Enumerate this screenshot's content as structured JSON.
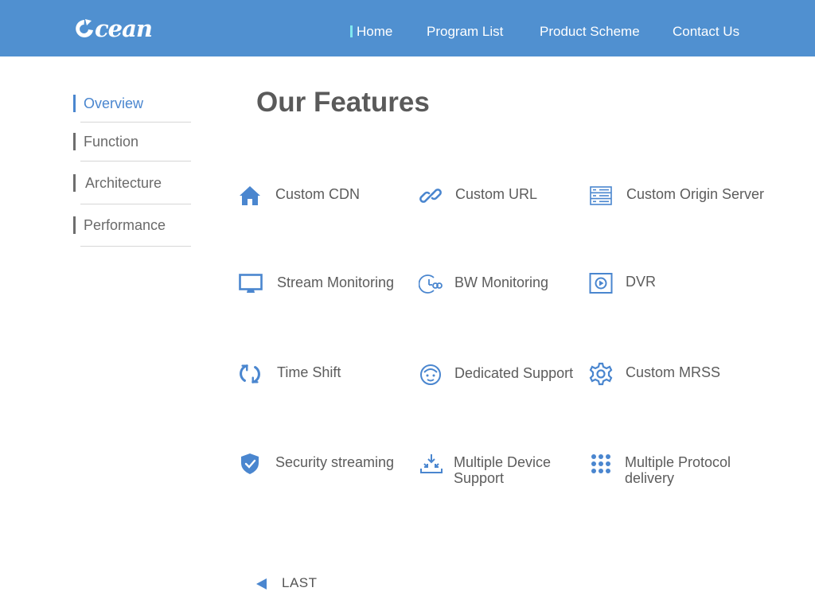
{
  "colors": {
    "header_bg": "#5090d0",
    "accent": "#4a86cf",
    "nav_active_marker": "#7fe8f0",
    "text": "#5c5c5c"
  },
  "logo": {
    "text": "cean"
  },
  "nav": {
    "items": [
      {
        "label": "Home",
        "active": true
      },
      {
        "label": "Program List",
        "active": false
      },
      {
        "label": "Product Scheme",
        "active": false
      },
      {
        "label": "Contact Us",
        "active": false
      }
    ]
  },
  "sidebar": {
    "items": [
      {
        "label": "Overview",
        "active": true
      },
      {
        "label": "Function",
        "active": false
      },
      {
        "label": "Architecture",
        "active": false
      },
      {
        "label": "Performance",
        "active": false
      }
    ]
  },
  "main": {
    "title": "Our Features",
    "features": [
      {
        "label": "Custom CDN",
        "icon": "home-icon"
      },
      {
        "label": "Custom URL",
        "icon": "link-icon"
      },
      {
        "label": "Custom Origin Server",
        "icon": "server-icon"
      },
      {
        "label": "Stream Monitoring",
        "icon": "monitor-icon"
      },
      {
        "label": "BW Monitoring",
        "icon": "bandwidth-gauge-icon"
      },
      {
        "label": "DVR",
        "icon": "video-play-icon"
      },
      {
        "label": "Time Shift",
        "icon": "refresh-icon"
      },
      {
        "label": "Dedicated Support",
        "icon": "support-agent-icon"
      },
      {
        "label": "Custom MRSS",
        "icon": "gear-icon"
      },
      {
        "label": "Security streaming",
        "icon": "shield-check-icon"
      },
      {
        "label": "Multiple Device Support",
        "icon": "download-tray-icon"
      },
      {
        "label": "Multiple Protocol delivery",
        "icon": "dot-grid-icon"
      }
    ]
  },
  "pager": {
    "label": "LAST"
  }
}
